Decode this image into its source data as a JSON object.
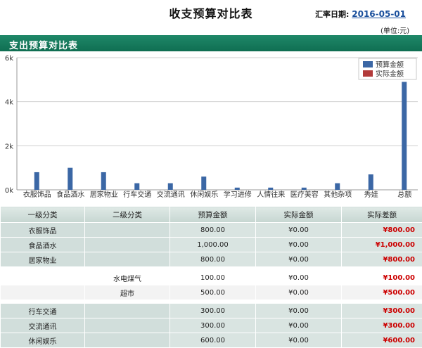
{
  "page": {
    "title": "收支预算对比表",
    "rate_label": "汇率日期:",
    "rate_date": "2016-05-01",
    "unit": "(单位:元)"
  },
  "section": {
    "title": "支出预算对比表"
  },
  "colors": {
    "budget": "#3b67a5",
    "actual": "#b23a3a",
    "header": "#137a5b",
    "diff": "#cc0000"
  },
  "chart_data": {
    "type": "bar",
    "categories": [
      "衣服饰品",
      "食品酒水",
      "居家物业",
      "行车交通",
      "交流通讯",
      "休闲娱乐",
      "学习进修",
      "人情往来",
      "医疗美容",
      "其他杂项",
      "秀娃",
      "总额"
    ],
    "series": [
      {
        "name": "预算金额",
        "values": [
          800,
          1000,
          800,
          300,
          300,
          600,
          100,
          100,
          100,
          300,
          700,
          4900
        ]
      },
      {
        "name": "实际金额",
        "values": [
          0,
          0,
          0,
          0,
          0,
          0,
          0,
          0,
          0,
          0,
          0,
          0
        ]
      }
    ],
    "yticks": [
      "0k",
      "2k",
      "4k",
      "6k"
    ],
    "ylim": [
      0,
      6000
    ],
    "legend": "top-right",
    "grid": true
  },
  "table": {
    "headers": [
      "一级分类",
      "二级分类",
      "预算金额",
      "实际金额",
      "实际差额"
    ],
    "rows": [
      {
        "level": 1,
        "cat1": "衣服饰品",
        "cat2": "",
        "budget": "800.00",
        "actual": "¥0.00",
        "diff": "¥800.00"
      },
      {
        "level": 1,
        "cat1": "食品酒水",
        "cat2": "",
        "budget": "1,000.00",
        "actual": "¥0.00",
        "diff": "¥1,000.00"
      },
      {
        "level": 1,
        "cat1": "居家物业",
        "cat2": "",
        "budget": "800.00",
        "actual": "¥0.00",
        "diff": "¥800.00"
      },
      {
        "level": 2,
        "cat1": "",
        "cat2": "水电煤气",
        "budget": "100.00",
        "actual": "¥0.00",
        "diff": "¥100.00"
      },
      {
        "level": 2,
        "cat1": "",
        "cat2": "超市",
        "budget": "500.00",
        "actual": "¥0.00",
        "diff": "¥500.00"
      },
      {
        "level": 1,
        "cat1": "行车交通",
        "cat2": "",
        "budget": "300.00",
        "actual": "¥0.00",
        "diff": "¥300.00"
      },
      {
        "level": 1,
        "cat1": "交流通讯",
        "cat2": "",
        "budget": "300.00",
        "actual": "¥0.00",
        "diff": "¥300.00"
      },
      {
        "level": 1,
        "cat1": "休闲娱乐",
        "cat2": "",
        "budget": "600.00",
        "actual": "¥0.00",
        "diff": "¥600.00"
      }
    ]
  }
}
